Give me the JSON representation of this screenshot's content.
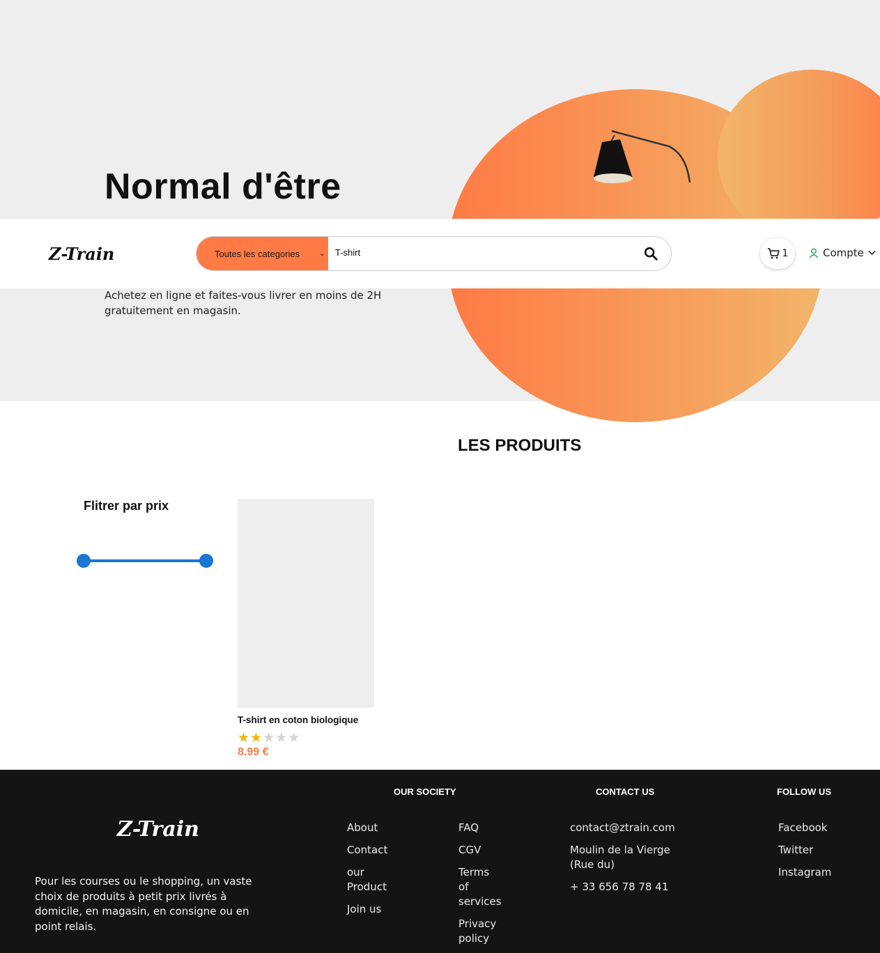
{
  "hero": {
    "title": "Normal d'être",
    "subtitle": "Achetez en ligne et faites-vous livrer en moins de 2H gratuitement en magasin."
  },
  "header": {
    "logo": "Z-Train",
    "search": {
      "category_selected": "Toutes les categories",
      "query": "T-shirt"
    },
    "cart_count": "1",
    "account_label": "Compte"
  },
  "products": {
    "section_title": "LES PRODUITS",
    "filter_title": "Flitrer par prix",
    "items": [
      {
        "name": "T-shirt en coton biologique",
        "rating": 2,
        "max_rating": 5,
        "price": "8.99 €"
      }
    ]
  },
  "footer": {
    "logo": "Z-Train",
    "description": "Pour les courses ou le shopping, un vaste choix de produits à petit prix livrés à domicile, en magasin, en consigne ou en point relais.",
    "our_society": {
      "heading": "OUR SOCIETY",
      "col1": [
        "About",
        "Contact",
        "our Product",
        "Join us"
      ],
      "col2": [
        "FAQ",
        "CGV",
        "Terms of services",
        "Privacy policy"
      ]
    },
    "contact": {
      "heading": "CONTACT US",
      "items": [
        "contact@ztrain.com",
        "Moulin de la Vierge (Rue du)",
        "+ 33 656 78 78 41"
      ]
    },
    "follow": {
      "heading": "FOLLOW US",
      "items": [
        "Facebook",
        "Twitter",
        "Instagram"
      ]
    }
  },
  "colors": {
    "accent": "#ff7a45",
    "slider": "#1976d2",
    "footer_bg": "#141414",
    "hero_bg": "#eeeeee"
  }
}
